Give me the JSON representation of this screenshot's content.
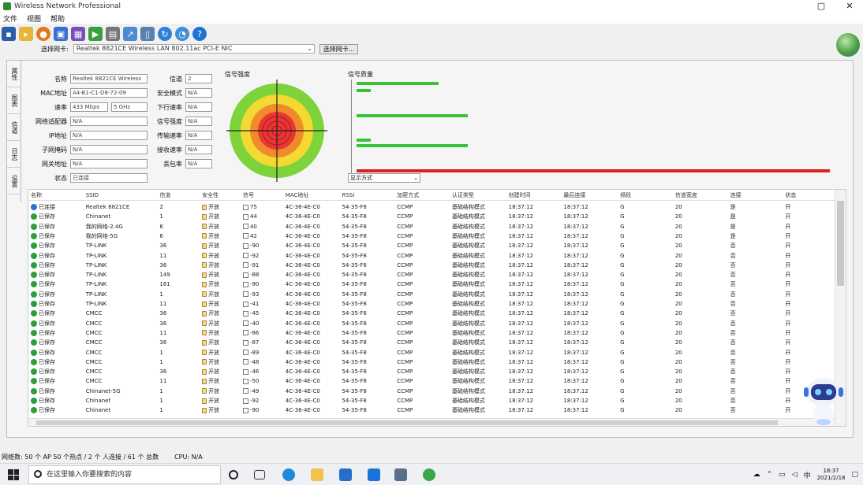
{
  "window": {
    "title": "Wireless Network Professional"
  },
  "menu": [
    "文件",
    "视图",
    "帮助"
  ],
  "toolbar": [
    "save-icon",
    "open-folder-icon",
    "disc-icon",
    "network-icon",
    "adapter-icon",
    "play-icon",
    "print-icon",
    "export-icon",
    "document-icon",
    "refresh-icon",
    "speed-icon",
    "help-icon"
  ],
  "filter": {
    "label": "选择网卡:",
    "value": "Realtek 8821CE Wireless LAN 802.11ac PCI-E NIC",
    "button": "选择网卡..."
  },
  "side_tabs": [
    "属性",
    "图表",
    "信道",
    "日志",
    "设置"
  ],
  "props_left": [
    {
      "label": "名称",
      "value": "Realtek 8821CE Wireless"
    },
    {
      "label": "MAC地址",
      "value": "A4-B1-C1-D8-72-09"
    },
    {
      "label": "速率",
      "value": "433 Mbps",
      "value2": "5 GHz"
    },
    {
      "label": "网络适配器",
      "value": "N/A"
    },
    {
      "label": "IP地址",
      "value": "N/A"
    },
    {
      "label": "子网掩码",
      "value": "N/A"
    },
    {
      "label": "网关地址",
      "value": "N/A"
    },
    {
      "label": "状态",
      "value": "已连接"
    }
  ],
  "props_right": [
    {
      "label": "信道",
      "value": "2"
    },
    {
      "label": "安全模式",
      "value": "N/A"
    },
    {
      "label": "下行速率",
      "value": "N/A"
    },
    {
      "label": "信号强度",
      "value": "N/A"
    },
    {
      "label": "传输速率",
      "value": "N/A"
    },
    {
      "label": "接收速率",
      "value": "N/A"
    },
    {
      "label": "丢包率",
      "value": "N/A"
    }
  ],
  "radar": {
    "label": "信号强度"
  },
  "bars": {
    "label": "信号质量",
    "dropdown": "显示方式",
    "values": [
      {
        "v": 0.17
      },
      {
        "v": 0.03
      },
      {
        "v": 0.23
      },
      {
        "v": 0.03
      },
      {
        "v": 0.23
      },
      {
        "v": 0.98,
        "color": "#dd2020"
      }
    ]
  },
  "table": {
    "headers": [
      "名称",
      "SSID",
      "信道",
      "安全性",
      "信号",
      "MAC地址",
      "RSSI",
      "加密方式",
      "认证类型",
      "创建时间",
      "最后连接",
      "频段",
      "信道宽度",
      "连接",
      "状态"
    ],
    "rows": [
      [
        "已连接",
        "Realtek 8821CE",
        "2",
        "开放",
        "75",
        "4C-36-4E-C0",
        "54-35-F8",
        "CCMP",
        "基础结构模式",
        "18:37:12",
        "18:37:12",
        "G",
        "20",
        "是",
        "开"
      ],
      [
        "已保存",
        "Chinanet",
        "1",
        "开放",
        "44",
        "4C-36-4E-C0",
        "54-35-F8",
        "CCMP",
        "基础结构模式",
        "18:37:12",
        "18:37:12",
        "G",
        "20",
        "是",
        "开"
      ],
      [
        "已保存",
        "我的网络-2.4G",
        "6",
        "开放",
        "40",
        "4C-36-4E-C0",
        "54-35-F8",
        "CCMP",
        "基础结构模式",
        "18:37:12",
        "18:37:12",
        "G",
        "20",
        "是",
        "开"
      ],
      [
        "已保存",
        "我的网络-5G",
        "6",
        "开放",
        "42",
        "4C-36-4E-C0",
        "54-35-F8",
        "CCMP",
        "基础结构模式",
        "18:37:12",
        "18:37:12",
        "G",
        "20",
        "是",
        "开"
      ],
      [
        "已保存",
        "TP-LINK",
        "36",
        "开放",
        "-90",
        "4C-36-4E-C0",
        "54-35-F8",
        "CCMP",
        "基础结构模式",
        "18:37:12",
        "18:37:12",
        "G",
        "20",
        "否",
        "开"
      ],
      [
        "已保存",
        "TP-LINK",
        "11",
        "开放",
        "-92",
        "4C-36-4E-C0",
        "54-35-F8",
        "CCMP",
        "基础结构模式",
        "18:37:12",
        "18:37:12",
        "G",
        "20",
        "否",
        "开"
      ],
      [
        "已保存",
        "TP-LINK",
        "36",
        "开放",
        "-91",
        "4C-36-4E-C0",
        "54-35-F8",
        "CCMP",
        "基础结构模式",
        "18:37:12",
        "18:37:12",
        "G",
        "20",
        "否",
        "开"
      ],
      [
        "已保存",
        "TP-LINK",
        "149",
        "开放",
        "-88",
        "4C-36-4E-C0",
        "54-35-F8",
        "CCMP",
        "基础结构模式",
        "18:37:12",
        "18:37:12",
        "G",
        "20",
        "否",
        "开"
      ],
      [
        "已保存",
        "TP-LINK",
        "161",
        "开放",
        "-90",
        "4C-36-4E-C0",
        "54-35-F8",
        "CCMP",
        "基础结构模式",
        "18:37:12",
        "18:37:12",
        "G",
        "20",
        "否",
        "开"
      ],
      [
        "已保存",
        "TP-LINK",
        "1",
        "开放",
        "-93",
        "4C-36-4E-C0",
        "54-35-F8",
        "CCMP",
        "基础结构模式",
        "18:37:12",
        "18:37:12",
        "G",
        "20",
        "否",
        "开"
      ],
      [
        "已保存",
        "TP-LINK",
        "11",
        "开放",
        "-41",
        "4C-36-4E-C0",
        "54-35-F8",
        "CCMP",
        "基础结构模式",
        "18:37:12",
        "18:37:12",
        "G",
        "20",
        "否",
        "开"
      ],
      [
        "已保存",
        "CMCC",
        "36",
        "开放",
        "-45",
        "4C-36-4E-C0",
        "54-35-F8",
        "CCMP",
        "基础结构模式",
        "18:37:12",
        "18:37:12",
        "G",
        "20",
        "否",
        "开"
      ],
      [
        "已保存",
        "CMCC",
        "36",
        "开放",
        "-40",
        "4C-36-4E-C0",
        "54-35-F8",
        "CCMP",
        "基础结构模式",
        "18:37:12",
        "18:37:12",
        "G",
        "20",
        "否",
        "开"
      ],
      [
        "已保存",
        "CMCC",
        "11",
        "开放",
        "-86",
        "4C-36-4E-C0",
        "54-35-F8",
        "CCMP",
        "基础结构模式",
        "18:37:12",
        "18:37:12",
        "G",
        "20",
        "否",
        "开"
      ],
      [
        "已保存",
        "CMCC",
        "36",
        "开放",
        "-87",
        "4C-36-4E-C0",
        "54-35-F8",
        "CCMP",
        "基础结构模式",
        "18:37:12",
        "18:37:12",
        "G",
        "20",
        "否",
        "开"
      ],
      [
        "已保存",
        "CMCC",
        "1",
        "开放",
        "-89",
        "4C-36-4E-C0",
        "54-35-F8",
        "CCMP",
        "基础结构模式",
        "18:37:12",
        "18:37:12",
        "G",
        "20",
        "否",
        "开"
      ],
      [
        "已保存",
        "CMCC",
        "1",
        "开放",
        "-48",
        "4C-36-4E-C0",
        "54-35-F8",
        "CCMP",
        "基础结构模式",
        "18:37:12",
        "18:37:12",
        "G",
        "20",
        "否",
        "开"
      ],
      [
        "已保存",
        "CMCC",
        "36",
        "开放",
        "-46",
        "4C-36-4E-C0",
        "54-35-F8",
        "CCMP",
        "基础结构模式",
        "18:37:12",
        "18:37:12",
        "G",
        "20",
        "否",
        "开"
      ],
      [
        "已保存",
        "CMCC",
        "11",
        "开放",
        "-50",
        "4C-36-4E-C0",
        "54-35-F8",
        "CCMP",
        "基础结构模式",
        "18:37:12",
        "18:37:12",
        "G",
        "20",
        "否",
        "开"
      ],
      [
        "已保存",
        "Chinanet-5G",
        "1",
        "开放",
        "-49",
        "4C-36-4E-C0",
        "54-35-F8",
        "CCMP",
        "基础结构模式",
        "18:37:12",
        "18:37:12",
        "G",
        "20",
        "否",
        "开"
      ],
      [
        "已保存",
        "Chinanet",
        "1",
        "开放",
        "-92",
        "4C-36-4E-C0",
        "54-35-F8",
        "CCMP",
        "基础结构模式",
        "18:37:12",
        "18:37:12",
        "G",
        "20",
        "否",
        "开"
      ],
      [
        "已保存",
        "Chinanet",
        "1",
        "开放",
        "-90",
        "4C-36-4E-C0",
        "54-35-F8",
        "CCMP",
        "基础结构模式",
        "18:37:12",
        "18:37:12",
        "G",
        "20",
        "否",
        "开"
      ]
    ]
  },
  "status": {
    "left": "网络数: 50 个 AP 50 个热点 / 2 个 人连接 / 61 个 总数",
    "right": "CPU: N/A"
  },
  "taskbar": {
    "search_placeholder": "在这里输入你要搜索的内容",
    "ime": "中",
    "time": "18:37",
    "date": "2021/2/18"
  }
}
